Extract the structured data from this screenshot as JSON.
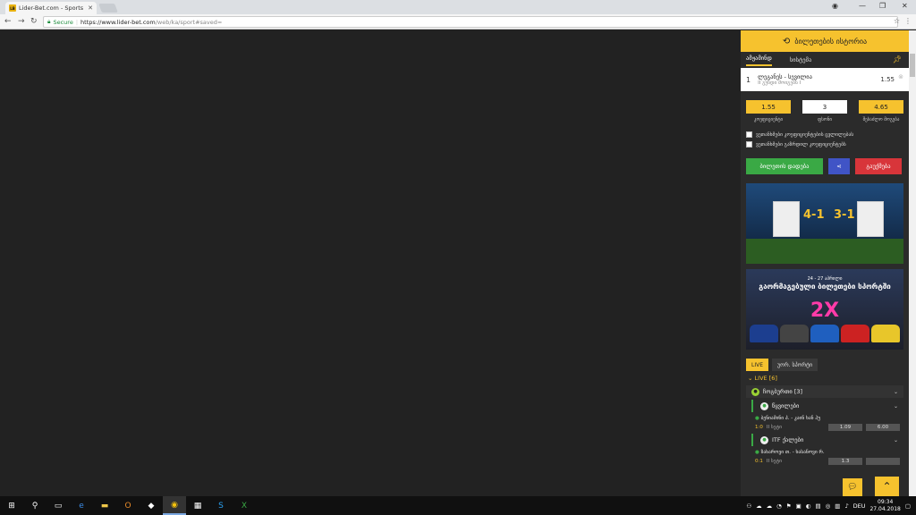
{
  "browser": {
    "tab_title": "Lider-Bet.com - Sports a",
    "favicon_text": "LB",
    "secure_label": "Secure",
    "url_host": "https://www.lider-bet.com",
    "url_path": "/web/ka/sport#saved="
  },
  "panel": {
    "history_title": "ბილეთების ისტორია",
    "tabs": [
      "ამჟამინდ",
      "სისტემა"
    ],
    "bet": {
      "num": "1",
      "match": "ლეგანეს - სევილია",
      "sub": "II გუნდი მოიგებს I",
      "odd": "1.55"
    },
    "stats": [
      {
        "value": "1.55",
        "label": "კოეფიციენტი"
      },
      {
        "value": "3",
        "label": "ფსონი"
      },
      {
        "value": "4.65",
        "label": "შესაძლო მოგება"
      }
    ],
    "checks": [
      "ვეთანხმები კოეფიციენტების ცვლილებას",
      "ვეთანხმები გაზრდილ კოეფიციენტებს"
    ],
    "place_bet": "ბილეთის დადება",
    "share": "<",
    "clear": "გაუქმება",
    "banner1": {
      "score_left": "4-1",
      "score_right": "3-1"
    },
    "banner2": {
      "date": "24 - 27 აპრილი",
      "title": "გაორმაგებული ბილეთები სპორტში",
      "multiplier": "2X"
    },
    "live_tab": "LIVE",
    "sched_tab": "უორ. სპორტი",
    "live_header": "LIVE [6]",
    "sport": "ჩოგბურთი [3]",
    "leagues": [
      {
        "name": "წყვილები",
        "match": "ბენიამინი პ. - კაინ ხან ჰუ",
        "score": "1:0",
        "set": "II სეტი",
        "odd1": "1.09",
        "odd2": "6.00"
      },
      {
        "name": "ITF ქალები",
        "match": "ზახაროვი თ. - ხასანოვი რ.",
        "score": "0:1",
        "set": "II სეტი",
        "odd1": "1.3",
        "odd2": ""
      }
    ]
  },
  "taskbar": {
    "lang": "DEU",
    "time": "09:34",
    "date": "27.04.2018"
  },
  "colors": {
    "accent": "#f6c22e",
    "green": "#3aa945",
    "blue": "#4054c6",
    "red": "#d8353a"
  }
}
